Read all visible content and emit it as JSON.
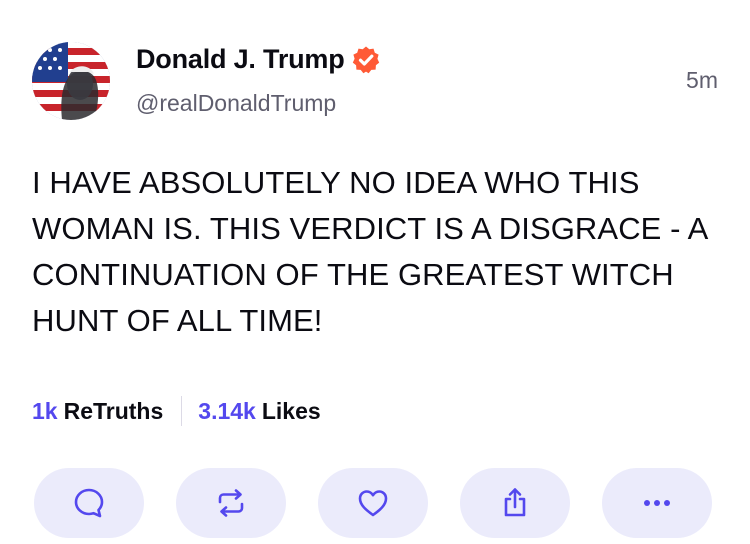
{
  "post": {
    "display_name": "Donald J. Trump",
    "handle": "@realDonaldTrump",
    "time": "5m",
    "verified_icon": "verified-badge-icon",
    "text": "I HAVE ABSOLUTELY NO IDEA WHO THIS WOMAN IS. THIS VERDICT IS A DISGRACE - A CONTINUATION OF THE GREATEST WITCH HUNT OF ALL TIME!"
  },
  "stats": {
    "retruths_count": "1k",
    "retruths_label": "ReTruths",
    "likes_count": "3.14k",
    "likes_label": "Likes"
  },
  "actions": [
    {
      "icon": "reply-icon"
    },
    {
      "icon": "retruth-icon"
    },
    {
      "icon": "like-icon"
    },
    {
      "icon": "share-icon"
    },
    {
      "icon": "more-icon"
    }
  ],
  "colors": {
    "accent": "#5448ee",
    "verified": "#ff5a36",
    "button_bg": "#ebebfb",
    "muted_text": "#5f5e6e"
  }
}
